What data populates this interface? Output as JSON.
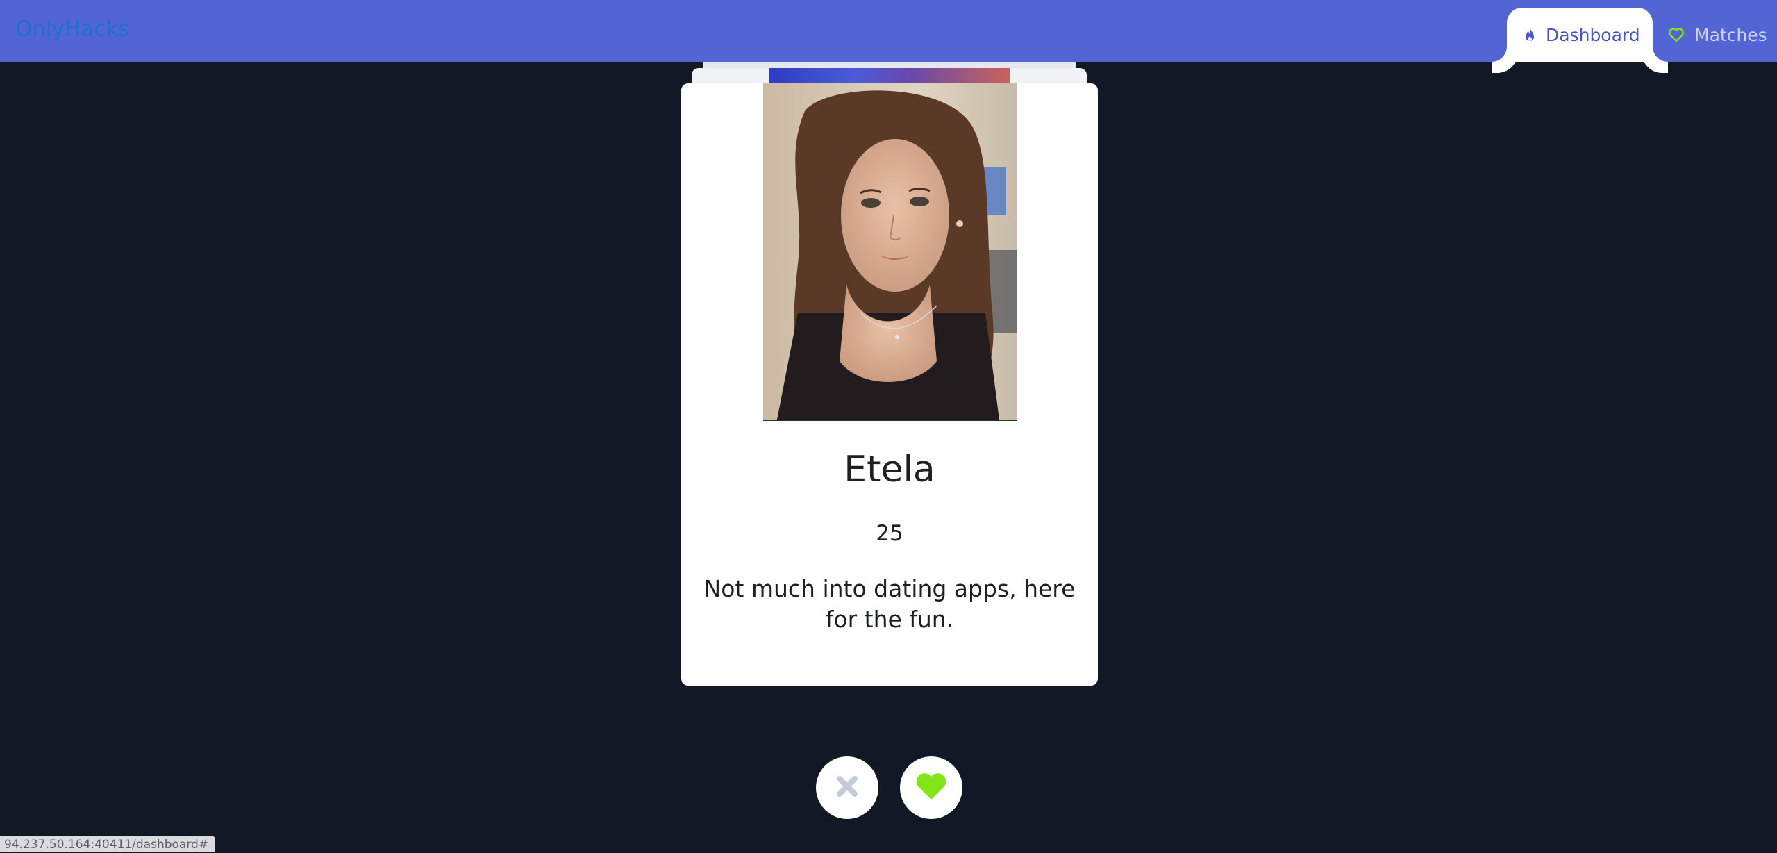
{
  "app": {
    "brand": "OnlyHacks"
  },
  "nav": {
    "items": [
      {
        "label": "Dashboard",
        "icon": "flame-icon",
        "active": true
      },
      {
        "label": "Matches",
        "icon": "heart-outline-icon",
        "active": false
      }
    ]
  },
  "profile": {
    "name": "Etela",
    "age": "25",
    "bio": "Not much into dating apps, here for the fun."
  },
  "actions": {
    "nope_icon": "x-icon",
    "like_icon": "heart-icon"
  },
  "status_bar": {
    "url": "94.237.50.164:40411/dashboard#"
  },
  "colors": {
    "navbar": "#5364d4",
    "background": "#121826",
    "brand_text": "#1d6fd1",
    "like_green": "#84e41a",
    "nope_gray": "#c3cbd6"
  }
}
